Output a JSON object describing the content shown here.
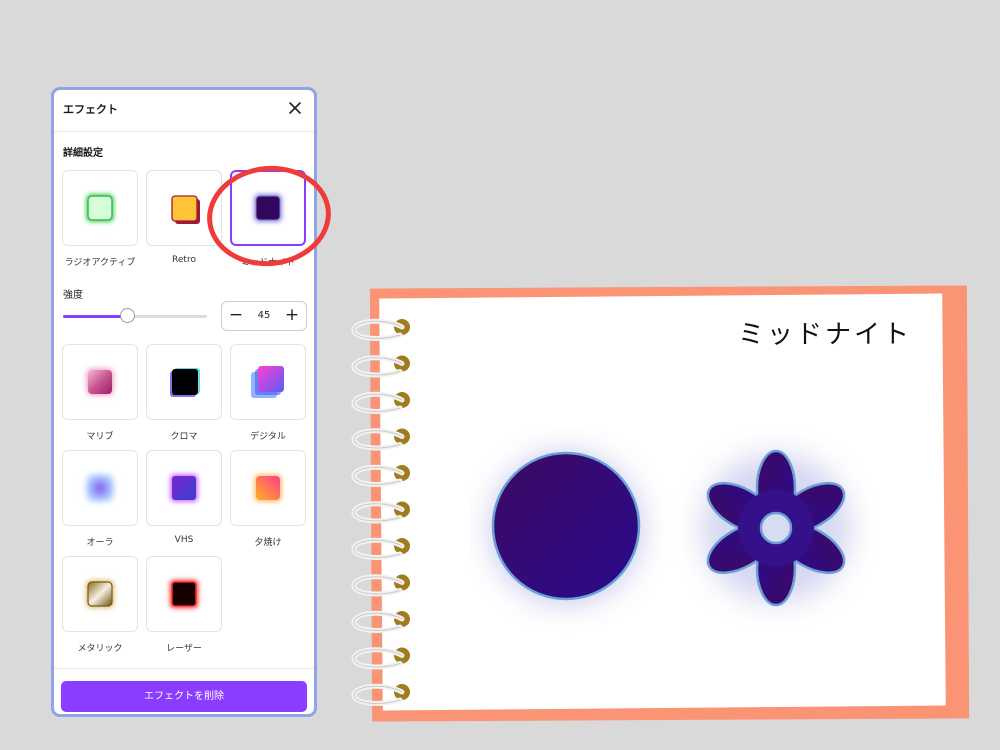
{
  "panel": {
    "title": "エフェクト",
    "section_title": "詳細設定",
    "intensity": {
      "label": "強度",
      "value": "45",
      "fraction": 0.45
    },
    "remove_button": "エフェクトを削除"
  },
  "effects_top": [
    {
      "label": "ラジオアクティブ",
      "icon": "radioactive-thumb"
    },
    {
      "label": "Retro",
      "icon": "retro-thumb"
    },
    {
      "label": "ミッドナイト",
      "icon": "midnight-thumb",
      "selected": true
    }
  ],
  "effects_grid": [
    {
      "label": "マリブ",
      "icon": "malibu-thumb"
    },
    {
      "label": "クロマ",
      "icon": "chroma-thumb"
    },
    {
      "label": "デジタル",
      "icon": "digital-thumb"
    },
    {
      "label": "オーラ",
      "icon": "aura-thumb"
    },
    {
      "label": "VHS",
      "icon": "vhs-thumb"
    },
    {
      "label": "夕焼け",
      "icon": "sunset-thumb"
    },
    {
      "label": "メタリック",
      "icon": "metallic-thumb"
    },
    {
      "label": "レーザー",
      "icon": "laser-thumb"
    }
  ],
  "canvas": {
    "title": "ミッドナイト"
  },
  "colors": {
    "accent": "#8b3dff",
    "panel_border": "#8fa3e6",
    "annotation": "#ef3b3b",
    "notebook_back": "#fa9475",
    "midnight_dark": "#3b0764",
    "midnight_mid": "#2e0c8a"
  }
}
